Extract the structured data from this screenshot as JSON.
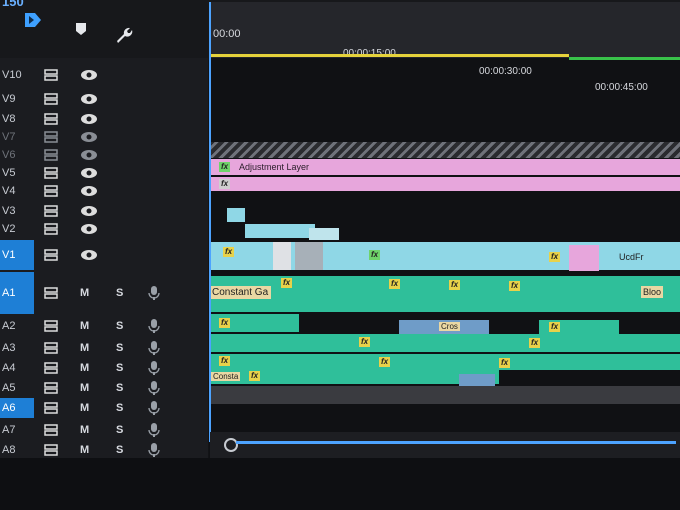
{
  "toolbar": {
    "title_fragment": "150",
    "tools": [
      "snap-icon",
      "marker-icon",
      "wrench-icon"
    ],
    "right_icons": [
      "export-frame-icon",
      "step-icon",
      "play-icon",
      "camera-icon",
      "grid-icon",
      "lift-icon"
    ]
  },
  "timecodes": [
    "00:00",
    "00:00:15:00",
    "00:00:30:00",
    "00:00:45:00"
  ],
  "video_tracks": [
    {
      "label": "V10",
      "visible": true
    },
    {
      "label": "V9",
      "visible": true
    },
    {
      "label": "V8",
      "visible": true
    },
    {
      "label": "V7",
      "visible": false
    },
    {
      "label": "V6",
      "visible": false
    },
    {
      "label": "V5",
      "visible": true
    },
    {
      "label": "V4",
      "visible": true
    },
    {
      "label": "V3",
      "visible": true
    },
    {
      "label": "V2",
      "visible": true
    },
    {
      "label": "V1",
      "visible": true
    }
  ],
  "audio_tracks": [
    {
      "label": "A1",
      "mute": "M",
      "solo": "S"
    },
    {
      "label": "A2",
      "mute": "M",
      "solo": "S"
    },
    {
      "label": "A3",
      "mute": "M",
      "solo": "S"
    },
    {
      "label": "A4",
      "mute": "M",
      "solo": "S"
    },
    {
      "label": "A5",
      "mute": "M",
      "solo": "S"
    },
    {
      "label": "A6",
      "mute": "M",
      "solo": "S"
    },
    {
      "label": "A7",
      "mute": "M",
      "solo": "S"
    },
    {
      "label": "A8",
      "mute": "M",
      "solo": "S"
    }
  ],
  "clips": {
    "adjustment_layer": "Adjustment Layer",
    "fx_badge": "fx",
    "constant_gain": "Constant Ga",
    "constant_short": "Consta",
    "cross_fade": "Cros",
    "v1_end": "UcdFr",
    "a1_end": "Bloo"
  },
  "colors": {
    "accent": "#1e7fd6",
    "video_clip": "#8fd7e6",
    "pink_clip": "#e7a6dc",
    "audio_clip": "#2fbf9a",
    "fx_yellow": "#e8d24a"
  }
}
